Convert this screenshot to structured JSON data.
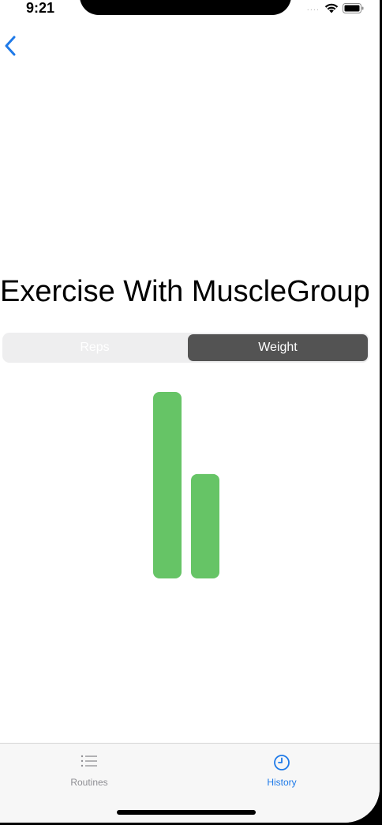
{
  "status_bar": {
    "time": "9:21",
    "signal": "....",
    "wifi_icon": "wifi-icon",
    "battery_icon": "battery-icon"
  },
  "nav": {
    "back_icon": "chevron-left-icon",
    "accent_color": "#1f7ae8"
  },
  "page": {
    "title": "Exercise With MuscleGroup"
  },
  "segmented_control": {
    "segments": [
      {
        "label": "Reps",
        "selected": false
      },
      {
        "label": "Weight",
        "selected": true
      }
    ],
    "selected_color": "#535353"
  },
  "chart_data": {
    "type": "bar",
    "categories": [
      "",
      ""
    ],
    "values": [
      1.0,
      0.56
    ],
    "bar_color": "#66c466",
    "title": "",
    "xlabel": "",
    "ylabel": "",
    "grid": false,
    "legend": "none"
  },
  "tab_bar": {
    "items": [
      {
        "label": "Routines",
        "icon": "list-icon",
        "selected": false
      },
      {
        "label": "History",
        "icon": "clock-icon",
        "selected": true
      }
    ],
    "active_color": "#1f7ae8",
    "inactive_color": "#8e8e93"
  }
}
